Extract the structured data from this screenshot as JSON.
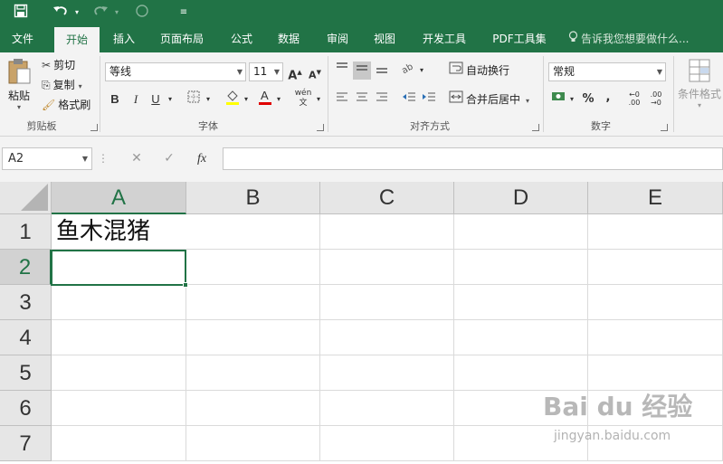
{
  "colors": {
    "brand": "#217346",
    "ribbon_bg": "#f3f3f3",
    "header_bg": "#e6e6e6",
    "selected_header_bg": "#d2d2d2"
  },
  "qat": {
    "save_icon": "save-icon",
    "undo_icon": "undo-icon",
    "redo_icon": "redo-icon",
    "circle_icon": "touch-mode-icon",
    "customize_icon": "customize-qat-icon"
  },
  "tabs": [
    {
      "label": "文件",
      "active": false
    },
    {
      "label": "开始",
      "active": true
    },
    {
      "label": "插入",
      "active": false
    },
    {
      "label": "页面布局",
      "active": false
    },
    {
      "label": "公式",
      "active": false
    },
    {
      "label": "数据",
      "active": false
    },
    {
      "label": "审阅",
      "active": false
    },
    {
      "label": "视图",
      "active": false
    },
    {
      "label": "开发工具",
      "active": false
    },
    {
      "label": "PDF工具集",
      "active": false
    }
  ],
  "tell_me": "告诉我您想要做什么...",
  "clipboard": {
    "paste": "粘贴",
    "cut": "剪切",
    "copy": "复制",
    "format_painter": "格式刷",
    "label": "剪贴板"
  },
  "font": {
    "name": "等线",
    "size": "11",
    "bold": "B",
    "italic": "I",
    "underline": "U",
    "phonetic": "wén",
    "label": "字体"
  },
  "alignment": {
    "wrap": "自动换行",
    "merge": "合并后居中",
    "label": "对齐方式"
  },
  "number": {
    "format": "常规",
    "percent": "%",
    "comma": ",",
    "label": "数字"
  },
  "styles": {
    "conditional": "条件格式"
  },
  "formula_bar": {
    "name_box": "A2",
    "cancel": "✕",
    "enter": "✓",
    "fx": "fx",
    "formula": ""
  },
  "columns": [
    "A",
    "B",
    "C",
    "D",
    "E"
  ],
  "rows": [
    "1",
    "2",
    "3",
    "4",
    "5",
    "6",
    "7"
  ],
  "cells": {
    "A1": "鱼木混猪"
  },
  "selected": {
    "column": "A",
    "row": "2"
  },
  "watermark": {
    "logo": "Bai du 经验",
    "url": "jingyan.baidu.com"
  }
}
